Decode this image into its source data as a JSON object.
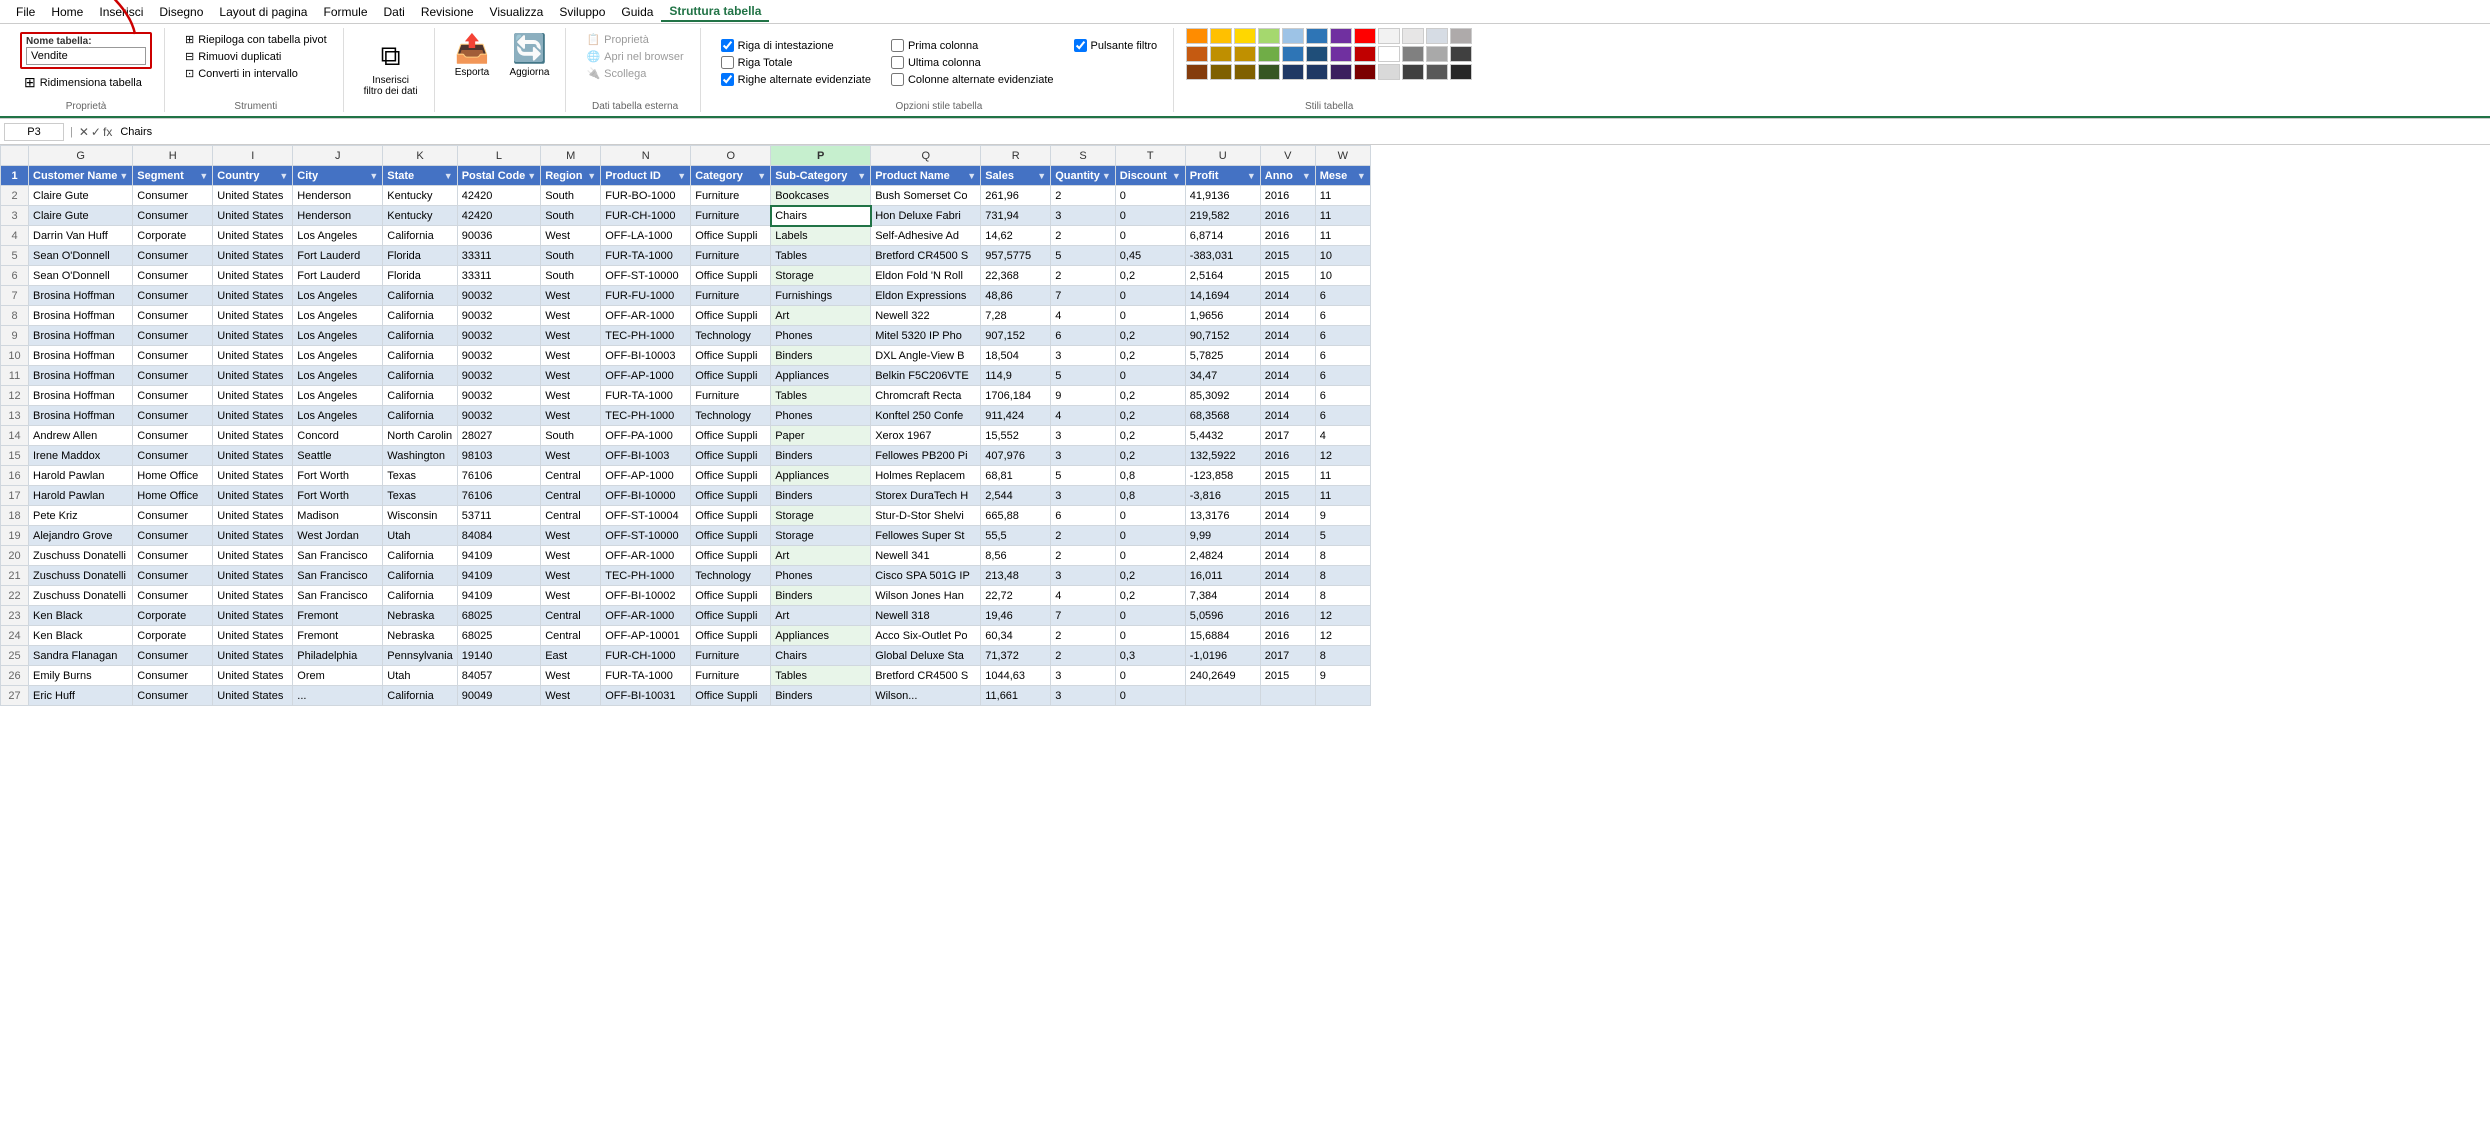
{
  "menubar": {
    "items": [
      "File",
      "Home",
      "Inserisci",
      "Disegno",
      "Layout di pagina",
      "Formule",
      "Dati",
      "Revisione",
      "Visualizza",
      "Sviluppo",
      "Guida",
      "Struttura tabella"
    ]
  },
  "ribbon": {
    "active_tab": "Struttura tabella",
    "groups": {
      "proprieta": {
        "label": "Proprietà",
        "name_label": "Nome tabella:",
        "name_value": "Vendite",
        "resize_label": "Ridimensiona tabella"
      },
      "strumenti": {
        "label": "Strumenti",
        "items": [
          "Riepilogа con tabella pivot",
          "Rimuovi duplicati",
          "Converti in intervallo"
        ]
      },
      "inserisci": {
        "label": "",
        "buttons": [
          "Inserisci filtro dei dati"
        ]
      },
      "esporta": {
        "label": "",
        "buttons": [
          "Esporta",
          "Aggiorna"
        ]
      },
      "dati_esterni": {
        "label": "Dati tabella esterna",
        "items": [
          "Proprietà",
          "Apri nel browser",
          "Scollega"
        ]
      },
      "opzioni": {
        "label": "Opzioni stile tabella",
        "checks": [
          {
            "label": "Riga di intestazione",
            "checked": true
          },
          {
            "label": "Riga Totale",
            "checked": false
          },
          {
            "label": "Righe alternate evidenziate",
            "checked": true
          },
          {
            "label": "Prima colonna",
            "checked": false
          },
          {
            "label": "Ultima colonna",
            "checked": false
          },
          {
            "label": "Colonne alternate evidenziate",
            "checked": false
          },
          {
            "label": "Pulsante filtro",
            "checked": true
          }
        ]
      }
    }
  },
  "formula_bar": {
    "cell_ref": "P3",
    "formula": "Chairs"
  },
  "columns": [
    "G",
    "H",
    "I",
    "J",
    "K",
    "L",
    "M",
    "N",
    "O",
    "P",
    "Q",
    "R",
    "S",
    "T",
    "U",
    "V",
    "W"
  ],
  "col_labels": {
    "G": "Customer Name",
    "H": "Segment",
    "I": "Country",
    "J": "City",
    "K": "State",
    "L": "Postal Code",
    "M": "Region",
    "N": "Product ID",
    "O": "Category",
    "P": "Sub-Category",
    "Q": "Product Name",
    "R": "Sales",
    "S": "Quantity",
    "T": "Discount",
    "U": "Profit",
    "V": "Anno",
    "W": "Mese"
  },
  "rows": [
    {
      "num": 2,
      "alt": false,
      "cells": [
        "Claire Gute",
        "Consumer",
        "United States",
        "Henderson",
        "Kentucky",
        "42420",
        "South",
        "FUR-BO-1000",
        "Furniture",
        "Bookcases",
        "Bush Somerset Co",
        "261,96",
        "2",
        "0",
        "41,9136",
        "2016",
        "11"
      ]
    },
    {
      "num": 3,
      "alt": true,
      "cells": [
        "Claire Gute",
        "Consumer",
        "United States",
        "Henderson",
        "Kentucky",
        "42420",
        "South",
        "FUR-CH-1000",
        "Furniture",
        "Chairs",
        "Hon Deluxe Fabri",
        "731,94",
        "3",
        "0",
        "219,582",
        "2016",
        "11"
      ],
      "selected_col": 9
    },
    {
      "num": 4,
      "alt": false,
      "cells": [
        "Darrin Van Huff",
        "Corporate",
        "United States",
        "Los Angeles",
        "California",
        "90036",
        "West",
        "OFF-LA-1000",
        "Office Suppli",
        "Labels",
        "Self-Adhesive Ad",
        "14,62",
        "2",
        "0",
        "6,8714",
        "2016",
        "11"
      ]
    },
    {
      "num": 5,
      "alt": true,
      "cells": [
        "Sean O'Donnell",
        "Consumer",
        "United States",
        "Fort Lauderd",
        "Florida",
        "33311",
        "South",
        "FUR-TA-1000",
        "Furniture",
        "Tables",
        "Bretford CR4500 S",
        "957,5775",
        "5",
        "0,45",
        "-383,031",
        "2015",
        "10"
      ]
    },
    {
      "num": 6,
      "alt": false,
      "cells": [
        "Sean O'Donnell",
        "Consumer",
        "United States",
        "Fort Lauderd",
        "Florida",
        "33311",
        "South",
        "OFF-ST-10000",
        "Office Suppli",
        "Storage",
        "Eldon Fold 'N Roll",
        "22,368",
        "2",
        "0,2",
        "2,5164",
        "2015",
        "10"
      ]
    },
    {
      "num": 7,
      "alt": true,
      "cells": [
        "Brosina Hoffman",
        "Consumer",
        "United States",
        "Los Angeles",
        "California",
        "90032",
        "West",
        "FUR-FU-1000",
        "Furniture",
        "Furnishings",
        "Eldon Expressions",
        "48,86",
        "7",
        "0",
        "14,1694",
        "2014",
        "6"
      ]
    },
    {
      "num": 8,
      "alt": false,
      "cells": [
        "Brosina Hoffman",
        "Consumer",
        "United States",
        "Los Angeles",
        "California",
        "90032",
        "West",
        "OFF-AR-1000",
        "Office Suppli",
        "Art",
        "Newell 322",
        "7,28",
        "4",
        "0",
        "1,9656",
        "2014",
        "6"
      ]
    },
    {
      "num": 9,
      "alt": true,
      "cells": [
        "Brosina Hoffman",
        "Consumer",
        "United States",
        "Los Angeles",
        "California",
        "90032",
        "West",
        "TEC-PH-1000",
        "Technology",
        "Phones",
        "Mitel 5320 IP Pho",
        "907,152",
        "6",
        "0,2",
        "90,7152",
        "2014",
        "6"
      ]
    },
    {
      "num": 10,
      "alt": false,
      "cells": [
        "Brosina Hoffman",
        "Consumer",
        "United States",
        "Los Angeles",
        "California",
        "90032",
        "West",
        "OFF-BI-10003",
        "Office Suppli",
        "Binders",
        "DXL Angle-View B",
        "18,504",
        "3",
        "0,2",
        "5,7825",
        "2014",
        "6"
      ]
    },
    {
      "num": 11,
      "alt": true,
      "cells": [
        "Brosina Hoffman",
        "Consumer",
        "United States",
        "Los Angeles",
        "California",
        "90032",
        "West",
        "OFF-AP-1000",
        "Office Suppli",
        "Appliances",
        "Belkin F5C206VTE",
        "114,9",
        "5",
        "0",
        "34,47",
        "2014",
        "6"
      ]
    },
    {
      "num": 12,
      "alt": false,
      "cells": [
        "Brosina Hoffman",
        "Consumer",
        "United States",
        "Los Angeles",
        "California",
        "90032",
        "West",
        "FUR-TA-1000",
        "Furniture",
        "Tables",
        "Chromcraft Recta",
        "1706,184",
        "9",
        "0,2",
        "85,3092",
        "2014",
        "6"
      ]
    },
    {
      "num": 13,
      "alt": true,
      "cells": [
        "Brosina Hoffman",
        "Consumer",
        "United States",
        "Los Angeles",
        "California",
        "90032",
        "West",
        "TEC-PH-1000",
        "Technology",
        "Phones",
        "Konftel 250 Confe",
        "911,424",
        "4",
        "0,2",
        "68,3568",
        "2014",
        "6"
      ]
    },
    {
      "num": 14,
      "alt": false,
      "cells": [
        "Andrew Allen",
        "Consumer",
        "United States",
        "Concord",
        "North Carolin",
        "28027",
        "South",
        "OFF-PA-1000",
        "Office Suppli",
        "Paper",
        "Xerox 1967",
        "15,552",
        "3",
        "0,2",
        "5,4432",
        "2017",
        "4"
      ]
    },
    {
      "num": 15,
      "alt": true,
      "cells": [
        "Irene Maddox",
        "Consumer",
        "United States",
        "Seattle",
        "Washington",
        "98103",
        "West",
        "OFF-BI-1003",
        "Office Suppli",
        "Binders",
        "Fellowes PB200 Pi",
        "407,976",
        "3",
        "0,2",
        "132,5922",
        "2016",
        "12"
      ]
    },
    {
      "num": 16,
      "alt": false,
      "cells": [
        "Harold Pawlan",
        "Home Office",
        "United States",
        "Fort Worth",
        "Texas",
        "76106",
        "Central",
        "OFF-AP-1000",
        "Office Suppli",
        "Appliances",
        "Holmes Replacem",
        "68,81",
        "5",
        "0,8",
        "-123,858",
        "2015",
        "11"
      ]
    },
    {
      "num": 17,
      "alt": true,
      "cells": [
        "Harold Pawlan",
        "Home Office",
        "United States",
        "Fort Worth",
        "Texas",
        "76106",
        "Central",
        "OFF-BI-10000",
        "Office Suppli",
        "Binders",
        "Storex DuraTech H",
        "2,544",
        "3",
        "0,8",
        "-3,816",
        "2015",
        "11"
      ]
    },
    {
      "num": 18,
      "alt": false,
      "cells": [
        "Pete Kriz",
        "Consumer",
        "United States",
        "Madison",
        "Wisconsin",
        "53711",
        "Central",
        "OFF-ST-10004",
        "Office Suppli",
        "Storage",
        "Stur-D-Stor Shelvi",
        "665,88",
        "6",
        "0",
        "13,3176",
        "2014",
        "9"
      ]
    },
    {
      "num": 19,
      "alt": true,
      "cells": [
        "Alejandro Grove",
        "Consumer",
        "United States",
        "West Jordan",
        "Utah",
        "84084",
        "West",
        "OFF-ST-10000",
        "Office Suppli",
        "Storage",
        "Fellowes Super St",
        "55,5",
        "2",
        "0",
        "9,99",
        "2014",
        "5"
      ]
    },
    {
      "num": 20,
      "alt": false,
      "cells": [
        "Zuschuss Donatelli",
        "Consumer",
        "United States",
        "San Francisco",
        "California",
        "94109",
        "West",
        "OFF-AR-1000",
        "Office Suppli",
        "Art",
        "Newell 341",
        "8,56",
        "2",
        "0",
        "2,4824",
        "2014",
        "8"
      ]
    },
    {
      "num": 21,
      "alt": true,
      "cells": [
        "Zuschuss Donatelli",
        "Consumer",
        "United States",
        "San Francisco",
        "California",
        "94109",
        "West",
        "TEC-PH-1000",
        "Technology",
        "Phones",
        "Cisco SPA 501G IP",
        "213,48",
        "3",
        "0,2",
        "16,011",
        "2014",
        "8"
      ]
    },
    {
      "num": 22,
      "alt": false,
      "cells": [
        "Zuschuss Donatelli",
        "Consumer",
        "United States",
        "San Francisco",
        "California",
        "94109",
        "West",
        "OFF-BI-10002",
        "Office Suppli",
        "Binders",
        "Wilson Jones Han",
        "22,72",
        "4",
        "0,2",
        "7,384",
        "2014",
        "8"
      ]
    },
    {
      "num": 23,
      "alt": true,
      "cells": [
        "Ken Black",
        "Corporate",
        "United States",
        "Fremont",
        "Nebraska",
        "68025",
        "Central",
        "OFF-AR-1000",
        "Office Suppli",
        "Art",
        "Newell 318",
        "19,46",
        "7",
        "0",
        "5,0596",
        "2016",
        "12"
      ]
    },
    {
      "num": 24,
      "alt": false,
      "cells": [
        "Ken Black",
        "Corporate",
        "United States",
        "Fremont",
        "Nebraska",
        "68025",
        "Central",
        "OFF-AP-10001",
        "Office Suppli",
        "Appliances",
        "Acco Six-Outlet Po",
        "60,34",
        "2",
        "0",
        "15,6884",
        "2016",
        "12"
      ]
    },
    {
      "num": 25,
      "alt": true,
      "cells": [
        "Sandra Flanagan",
        "Consumer",
        "United States",
        "Philadelphia",
        "Pennsylvania",
        "19140",
        "East",
        "FUR-CH-1000",
        "Furniture",
        "Chairs",
        "Global Deluxe Sta",
        "71,372",
        "2",
        "0,3",
        "-1,0196",
        "2017",
        "8"
      ]
    },
    {
      "num": 26,
      "alt": false,
      "cells": [
        "Emily Burns",
        "Consumer",
        "United States",
        "Orem",
        "Utah",
        "84057",
        "West",
        "FUR-TA-1000",
        "Furniture",
        "Tables",
        "Bretford CR4500 S",
        "1044,63",
        "3",
        "0",
        "240,2649",
        "2015",
        "9"
      ]
    },
    {
      "num": 27,
      "alt": true,
      "cells": [
        "Eric Huff",
        "Consumer",
        "United States",
        "...",
        "California",
        "90049",
        "West",
        "OFF-BI-10031",
        "Office Suppli",
        "Binders",
        "Wilson...",
        "11,661",
        "3",
        "0",
        "",
        "",
        ""
      ]
    }
  ],
  "swatches": {
    "row1": [
      "#FF7F00",
      "#FFC000",
      "#FFFF00",
      "#92D050",
      "#00B0F0",
      "#0070C0",
      "#7030A0",
      "#FF0000",
      "#FFFFFF",
      "#000000",
      "#D9D9D9",
      "#595959"
    ],
    "row2": [
      "#FF7F00",
      "#FFC000",
      "#FFFF00",
      "#92D050",
      "#00B0F0",
      "#0070C0",
      "#7030A0",
      "#FF0000",
      "#FFFFFF",
      "#000000",
      "#D9D9D9",
      "#595959"
    ],
    "row3": [
      "#FF7F00",
      "#FFC000",
      "#FFFF00",
      "#92D050",
      "#00B0F0",
      "#0070C0",
      "#7030A0",
      "#FF0000",
      "#FFFFFF",
      "#000000",
      "#D9D9D9",
      "#595959"
    ]
  }
}
